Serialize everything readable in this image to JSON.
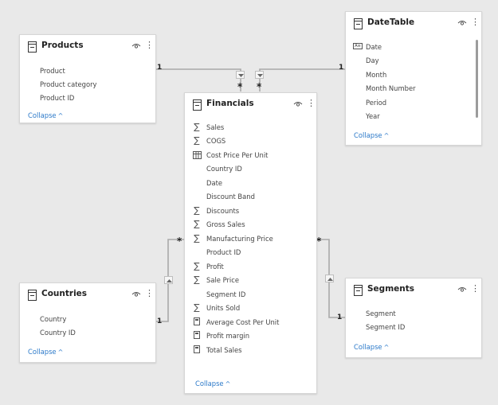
{
  "products": {
    "title": "Products",
    "fields": [
      "Product",
      "Product category",
      "Product ID"
    ],
    "collapse": "Collapse"
  },
  "datetable": {
    "title": "DateTable",
    "fields": [
      "Date",
      "Day",
      "Month",
      "Month Number",
      "Period",
      "Year"
    ],
    "collapse": "Collapse"
  },
  "financials": {
    "title": "Financials",
    "fields": [
      {
        "label": "Sales",
        "icon": "sigma"
      },
      {
        "label": "COGS",
        "icon": "sigma"
      },
      {
        "label": "Cost Price Per Unit",
        "icon": "table-calc"
      },
      {
        "label": "Country ID",
        "icon": ""
      },
      {
        "label": "Date",
        "icon": ""
      },
      {
        "label": "Discount Band",
        "icon": ""
      },
      {
        "label": "Discounts",
        "icon": "sigma"
      },
      {
        "label": "Gross Sales",
        "icon": "sigma"
      },
      {
        "label": "Manufacturing Price",
        "icon": "sigma"
      },
      {
        "label": "Product ID",
        "icon": ""
      },
      {
        "label": "Profit",
        "icon": "sigma"
      },
      {
        "label": "Sale Price",
        "icon": "sigma"
      },
      {
        "label": "Segment ID",
        "icon": ""
      },
      {
        "label": "Units Sold",
        "icon": "sigma"
      },
      {
        "label": "Average Cost Per Unit",
        "icon": "calculator"
      },
      {
        "label": "Profit margin",
        "icon": "calculator"
      },
      {
        "label": "Total Sales",
        "icon": "calculator"
      }
    ],
    "collapse": "Collapse"
  },
  "countries": {
    "title": "Countries",
    "fields": [
      "Country",
      "Country ID"
    ],
    "collapse": "Collapse"
  },
  "segments": {
    "title": "Segments",
    "fields": [
      "Segment",
      "Segment ID"
    ],
    "collapse": "Collapse"
  },
  "relationships": {
    "one": "1",
    "many": "*"
  },
  "icons": {
    "sigma": "∑",
    "view": "eye-icon",
    "more": "⋮",
    "chevron": "^"
  },
  "colors": {
    "canvas": "#e9e9e9",
    "link": "#2b79c9"
  }
}
